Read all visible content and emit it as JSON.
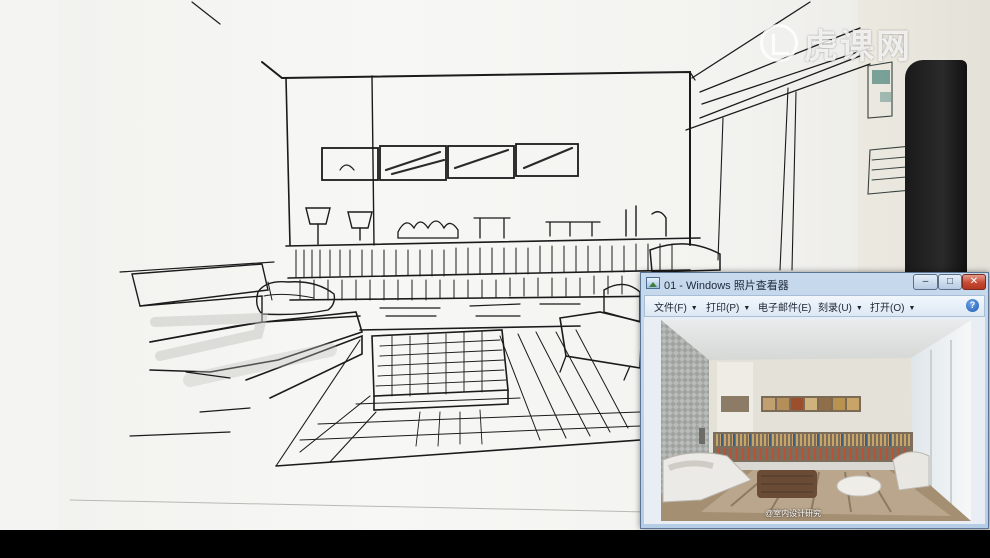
{
  "watermark": {
    "brand": "虎课网",
    "logo_icon": "huke-logo-icon"
  },
  "viewer": {
    "title": "01 - Windows 照片查看器",
    "buttons": {
      "minimize": "–",
      "maximize": "□",
      "close": "✕"
    },
    "menu": [
      {
        "label": "文件(F)",
        "has_dropdown": true
      },
      {
        "label": "打印(P)",
        "has_dropdown": true
      },
      {
        "label": "电子邮件(E)",
        "has_dropdown": false
      },
      {
        "label": "刻录(U)",
        "has_dropdown": true
      },
      {
        "label": "打开(O)",
        "has_dropdown": true
      }
    ],
    "help_label": "?",
    "photo_caption": "@室内设计研究"
  },
  "colors": {
    "sketch_ink": "#1b1b1b",
    "viewer_frame": "#b6cde6",
    "close_red": "#c64a32"
  }
}
